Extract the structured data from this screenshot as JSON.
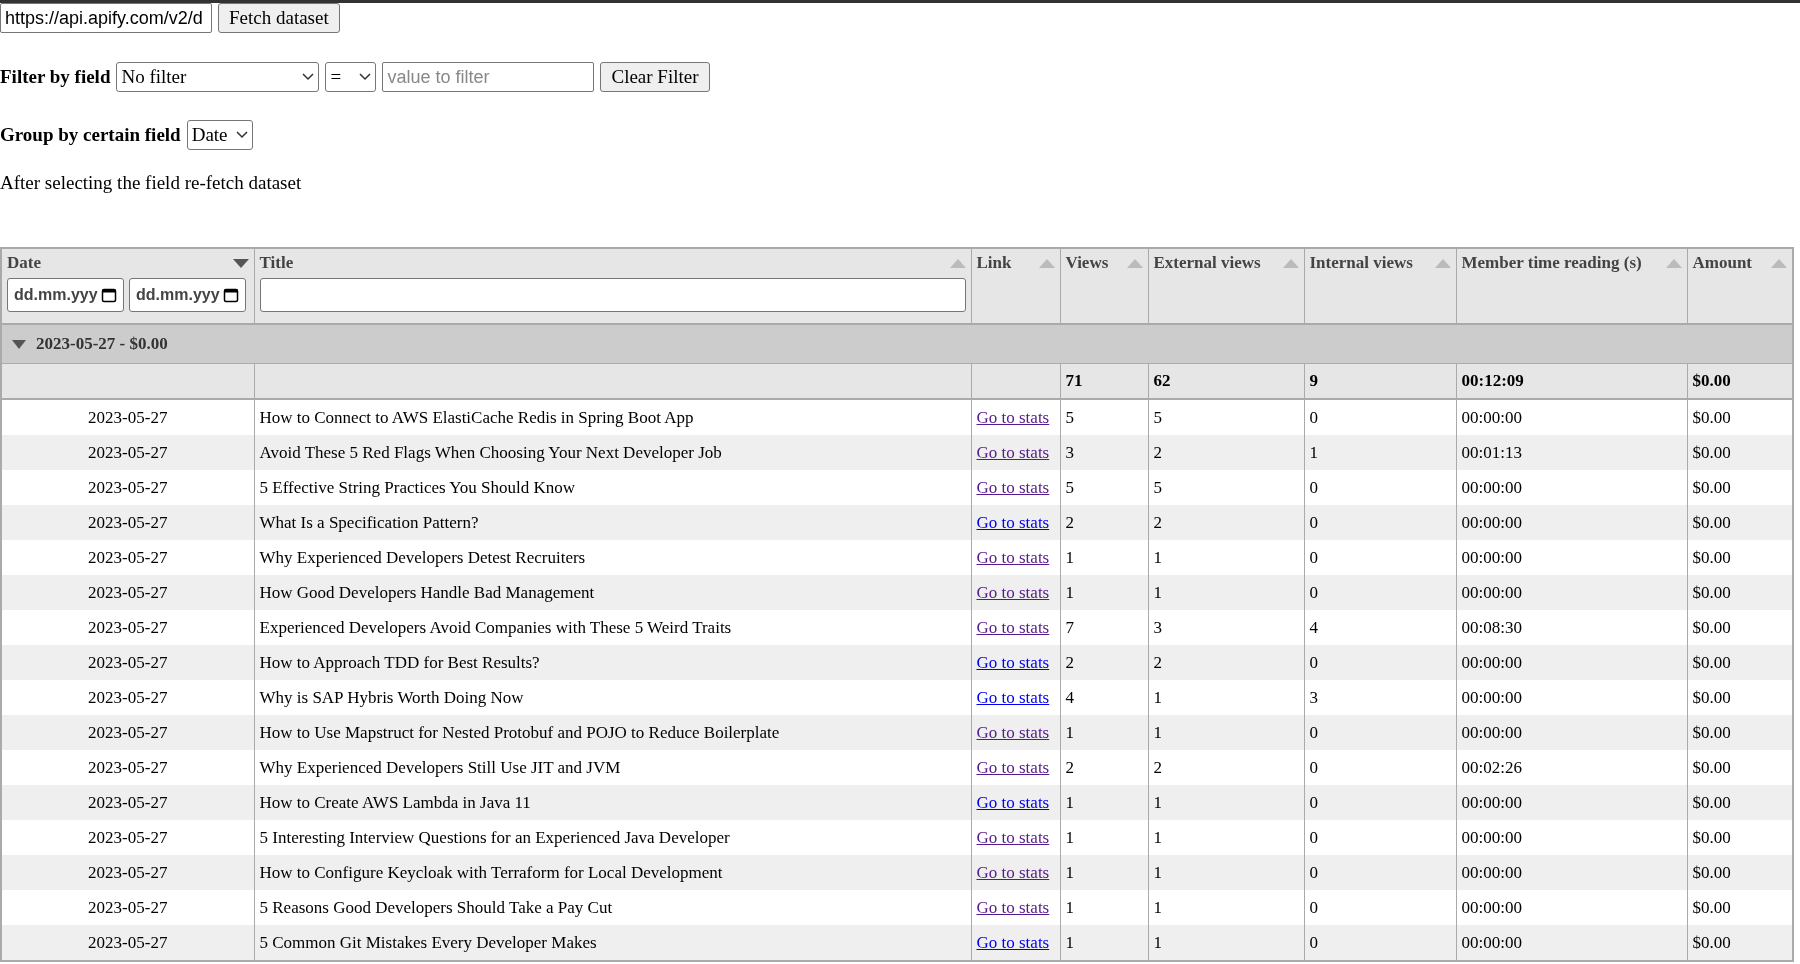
{
  "fetch": {
    "url": "https://api.apify.com/v2/d",
    "button": "Fetch dataset"
  },
  "filter": {
    "label": "Filter by field",
    "field": "No filter",
    "operator": "=",
    "placeholder": "value to filter",
    "button": "Clear Filter"
  },
  "group": {
    "label": "Group by certain field",
    "field": "Date"
  },
  "note": "After selecting the field re-fetch dataset",
  "table": {
    "columns": [
      {
        "label": "Date",
        "sorted": true,
        "date_filters": [
          {
            "placeholder": "dd.mm.yyy"
          },
          {
            "placeholder": "dd.mm.yyy"
          }
        ]
      },
      {
        "label": "Title",
        "sorted": false,
        "text_filter": true
      },
      {
        "label": "Link",
        "sorted": false
      },
      {
        "label": "Views",
        "sorted": false
      },
      {
        "label": "External views",
        "sorted": false
      },
      {
        "label": "Internal views",
        "sorted": false
      },
      {
        "label": "Member time reading (s)",
        "sorted": false
      },
      {
        "label": "Amount",
        "sorted": false
      }
    ],
    "group": {
      "label": "2023-05-27 - $0.00",
      "expanded": true
    },
    "totals": {
      "views": "71",
      "external": "62",
      "internal": "9",
      "time": "00:12:09",
      "amount": "$0.00"
    },
    "rows": [
      {
        "date": "2023-05-27",
        "title": "How to Connect to AWS ElastiCache Redis in Spring Boot App",
        "link": "Go to stats",
        "visited": true,
        "views": "5",
        "external": "5",
        "internal": "0",
        "time": "00:00:00",
        "amount": "$0.00"
      },
      {
        "date": "2023-05-27",
        "title": "Avoid These 5 Red Flags When Choosing Your Next Developer Job",
        "link": "Go to stats",
        "visited": true,
        "views": "3",
        "external": "2",
        "internal": "1",
        "time": "00:01:13",
        "amount": "$0.00"
      },
      {
        "date": "2023-05-27",
        "title": "5 Effective String Practices You Should Know",
        "link": "Go to stats",
        "visited": true,
        "views": "5",
        "external": "5",
        "internal": "0",
        "time": "00:00:00",
        "amount": "$0.00"
      },
      {
        "date": "2023-05-27",
        "title": "What Is a Specification Pattern?",
        "link": "Go to stats",
        "visited": false,
        "views": "2",
        "external": "2",
        "internal": "0",
        "time": "00:00:00",
        "amount": "$0.00"
      },
      {
        "date": "2023-05-27",
        "title": "Why Experienced Developers Detest Recruiters",
        "link": "Go to stats",
        "visited": true,
        "views": "1",
        "external": "1",
        "internal": "0",
        "time": "00:00:00",
        "amount": "$0.00"
      },
      {
        "date": "2023-05-27",
        "title": "How Good Developers Handle Bad Management",
        "link": "Go to stats",
        "visited": true,
        "views": "1",
        "external": "1",
        "internal": "0",
        "time": "00:00:00",
        "amount": "$0.00"
      },
      {
        "date": "2023-05-27",
        "title": "Experienced Developers Avoid Companies with These 5 Weird Traits",
        "link": "Go to stats",
        "visited": true,
        "views": "7",
        "external": "3",
        "internal": "4",
        "time": "00:08:30",
        "amount": "$0.00"
      },
      {
        "date": "2023-05-27",
        "title": "How to Approach TDD for Best Results?",
        "link": "Go to stats",
        "visited": false,
        "views": "2",
        "external": "2",
        "internal": "0",
        "time": "00:00:00",
        "amount": "$0.00"
      },
      {
        "date": "2023-05-27",
        "title": "Why is SAP Hybris Worth Doing Now",
        "link": "Go to stats",
        "visited": false,
        "views": "4",
        "external": "1",
        "internal": "3",
        "time": "00:00:00",
        "amount": "$0.00"
      },
      {
        "date": "2023-05-27",
        "title": "How to Use Mapstruct for Nested Protobuf and POJO to Reduce Boilerplate",
        "link": "Go to stats",
        "visited": true,
        "views": "1",
        "external": "1",
        "internal": "0",
        "time": "00:00:00",
        "amount": "$0.00"
      },
      {
        "date": "2023-05-27",
        "title": "Why Experienced Developers Still Use JIT and JVM",
        "link": "Go to stats",
        "visited": true,
        "views": "2",
        "external": "2",
        "internal": "0",
        "time": "00:02:26",
        "amount": "$0.00"
      },
      {
        "date": "2023-05-27",
        "title": "How to Create AWS Lambda in Java 11",
        "link": "Go to stats",
        "visited": false,
        "views": "1",
        "external": "1",
        "internal": "0",
        "time": "00:00:00",
        "amount": "$0.00"
      },
      {
        "date": "2023-05-27",
        "title": "5 Interesting Interview Questions for an Experienced Java Developer",
        "link": "Go to stats",
        "visited": true,
        "views": "1",
        "external": "1",
        "internal": "0",
        "time": "00:00:00",
        "amount": "$0.00"
      },
      {
        "date": "2023-05-27",
        "title": "How to Configure Keycloak with Terraform for Local Development",
        "link": "Go to stats",
        "visited": true,
        "views": "1",
        "external": "1",
        "internal": "0",
        "time": "00:00:00",
        "amount": "$0.00"
      },
      {
        "date": "2023-05-27",
        "title": "5 Reasons Good Developers Should Take a Pay Cut",
        "link": "Go to stats",
        "visited": true,
        "views": "1",
        "external": "1",
        "internal": "0",
        "time": "00:00:00",
        "amount": "$0.00"
      },
      {
        "date": "2023-05-27",
        "title": "5 Common Git Mistakes Every Developer Makes",
        "link": "Go to stats",
        "visited": false,
        "views": "1",
        "external": "1",
        "internal": "0",
        "time": "00:00:00",
        "amount": "$0.00"
      }
    ]
  }
}
